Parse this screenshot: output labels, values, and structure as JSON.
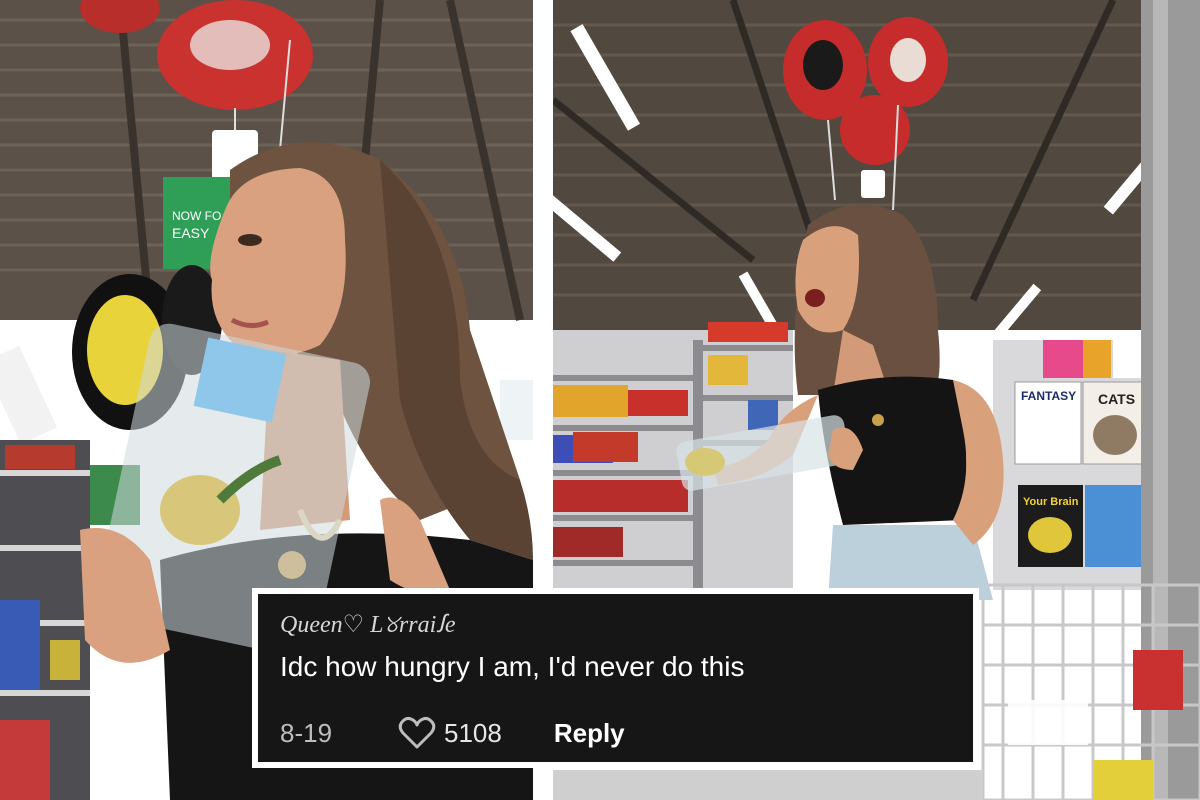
{
  "photos": {
    "left_sign_text_line1": "NOW FO",
    "left_sign_text_line2": "EASY"
  },
  "comment": {
    "username": "Queen♡ L୪rraiꭍe",
    "text": "Idc how hungry I am, I'd never do this",
    "date": "8-19",
    "like_count": "5108",
    "reply_label": "Reply",
    "like_icon": "heart-icon"
  },
  "magazines": {
    "m1": "FANTASY",
    "m2": "CATS",
    "m3": "Your Brain"
  },
  "colors": {
    "card_bg": "#161616",
    "card_border": "#ffffff",
    "accent_red": "#d42a2a"
  }
}
